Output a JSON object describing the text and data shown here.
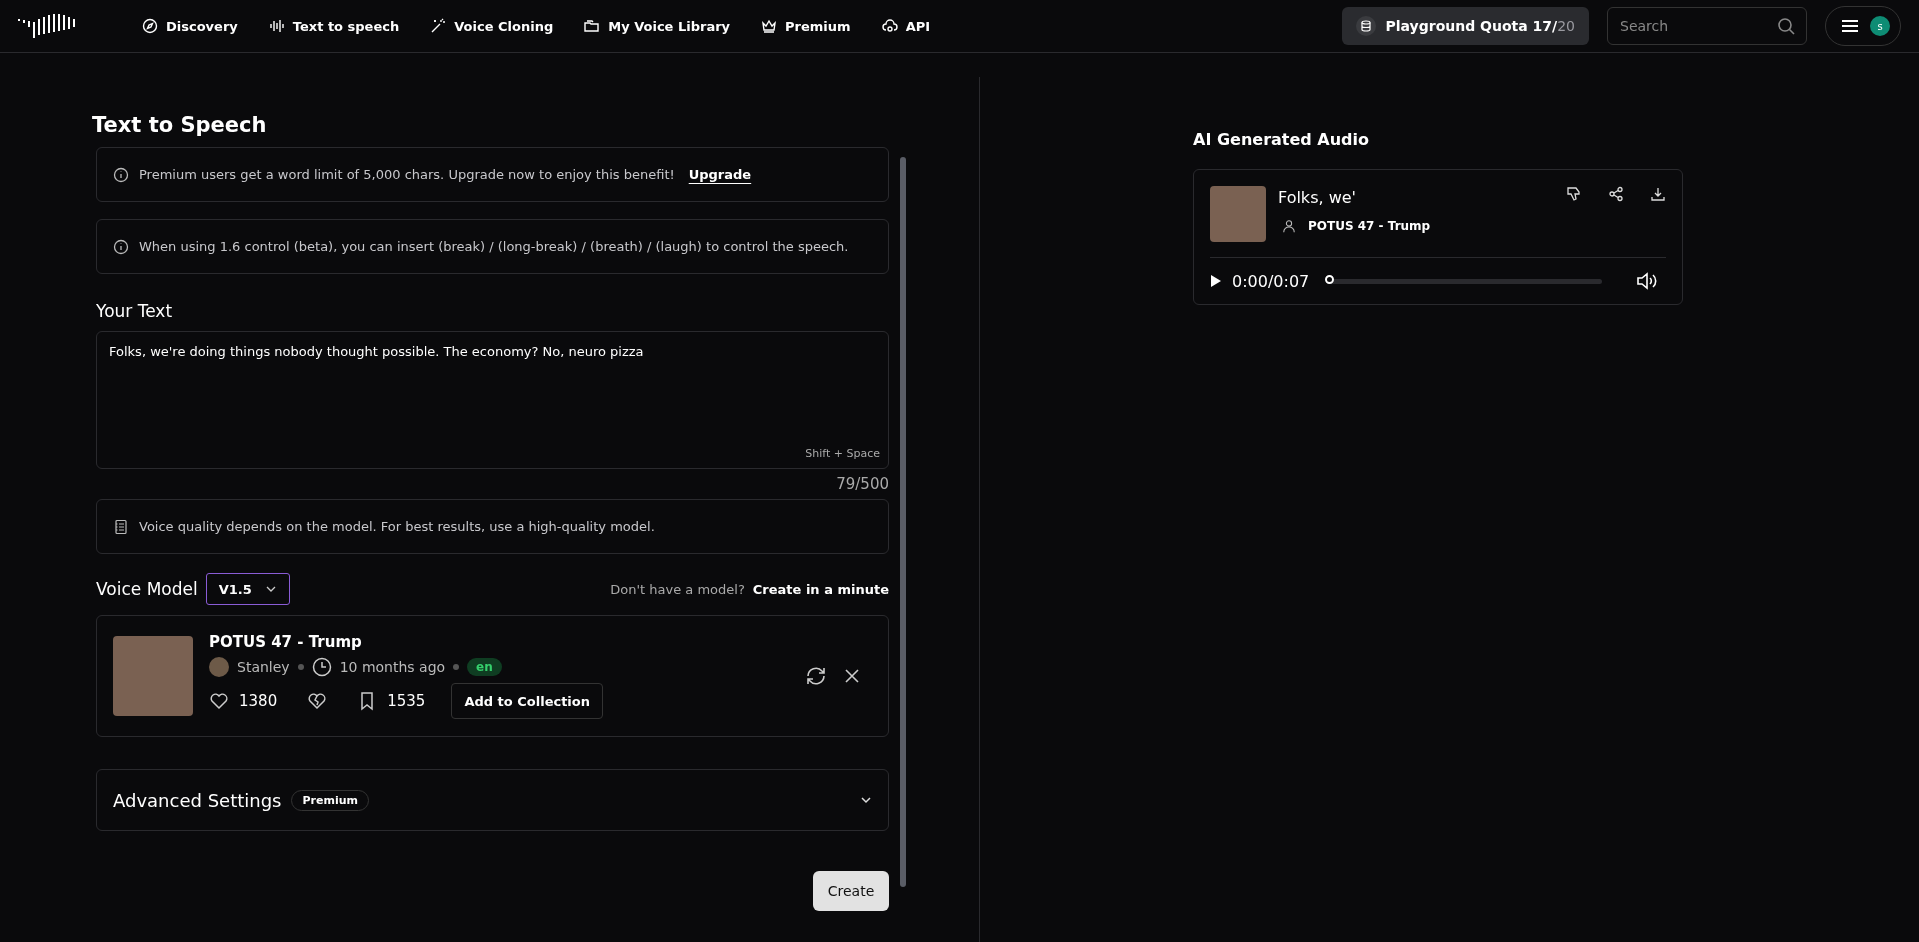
{
  "nav": {
    "items": [
      {
        "label": "Discovery"
      },
      {
        "label": "Text to speech"
      },
      {
        "label": "Voice Cloning"
      },
      {
        "label": "My Voice Library"
      },
      {
        "label": "Premium"
      },
      {
        "label": "API"
      }
    ],
    "quota": {
      "label": "Playground Quota 17/",
      "total": "20"
    },
    "search": {
      "placeholder": "Search"
    },
    "avatar": {
      "initial": "s"
    }
  },
  "editor": {
    "title": "Text to Speech",
    "notices": [
      {
        "text": "Premium users get a word limit of 5,000 chars. Upgrade now to enjoy this benefit!",
        "link": "Upgrade"
      },
      {
        "text": "When using 1.6 control (beta), you can insert (break) / (long-break) / (breath) / (laugh) to control the speech."
      }
    ],
    "text_label": "Your Text",
    "text_value": "Folks, we're doing things nobody thought possible. The economy? No, neuro pizza",
    "shortcut": "Shift + Space",
    "counter": "79/500",
    "quality_note": "Voice quality depends on the model. For best results, use a high-quality model.",
    "model_label": "Voice Model",
    "model_version": "V1.5",
    "model_hint": "Don't have a model?",
    "model_link": "Create in a minute",
    "voice": {
      "name": "POTUS 47 - Trump",
      "author": "Stanley",
      "age": "10 months ago",
      "language": "en",
      "likes": "1380",
      "saves": "1535",
      "collect_button": "Add to Collection"
    },
    "advanced": {
      "label": "Advanced Settings",
      "badge": "Premium",
      "expanded": false
    },
    "create_button": "Create"
  },
  "output": {
    "title": "AI Generated Audio",
    "audio": {
      "title": "Folks, we'",
      "voice": "POTUS 47 - Trump",
      "time": "0:00/0:07",
      "level": 0
    }
  }
}
